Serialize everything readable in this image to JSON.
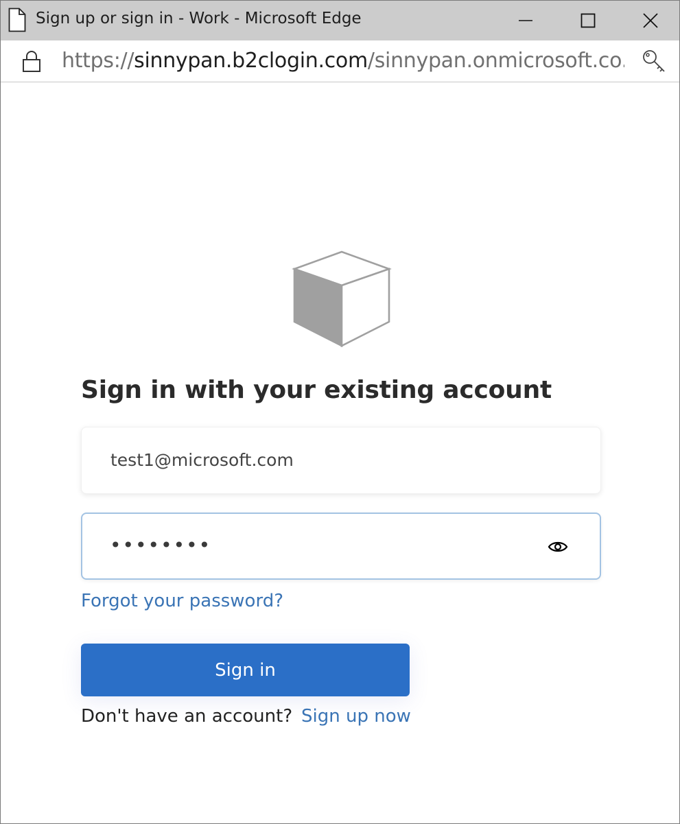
{
  "window": {
    "title": "Sign up or sign in - Work - Microsoft Edge"
  },
  "address_bar": {
    "url_scheme": "https://",
    "url_host": "sinnypan.b2clogin.com",
    "url_path": "/sinnypan.onmicrosoft.co..."
  },
  "signin": {
    "heading": "Sign in with your existing account",
    "email_value": "test1@microsoft.com",
    "password_masked": "••••••••",
    "forgot_password": "Forgot your password?",
    "sign_in_button": "Sign in",
    "no_account_text": "Don't have an account?",
    "sign_up_link": "Sign up now"
  },
  "icons": {
    "page": "page-icon",
    "minimize": "minimize-icon",
    "maximize": "maximize-icon",
    "close": "close-icon",
    "lock": "lock-icon",
    "key": "key-icon",
    "logo": "cube-logo",
    "eye": "eye-icon"
  },
  "colors": {
    "title_bar": "#cccccc",
    "link": "#3a74b5",
    "primary_button": "#2b6fc7",
    "focused_border": "#a3c3e3",
    "logo_grey": "#a0a0a0"
  }
}
